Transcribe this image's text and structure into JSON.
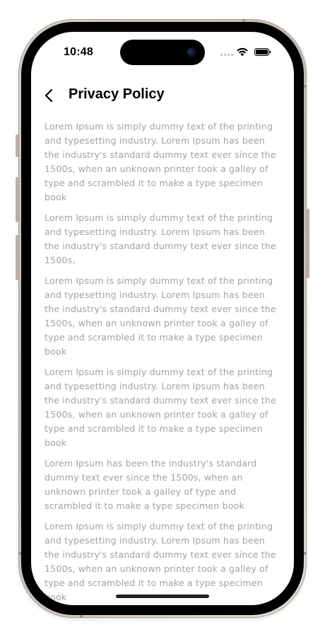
{
  "status_bar": {
    "time": "10:48"
  },
  "header": {
    "title": "Privacy Policy",
    "back_icon": "chevron-left-icon"
  },
  "content": {
    "paragraphs": [
      "Lorem Ipsum is simply dummy text of the printing and typesetting industry. Lorem Ipsum has been the industry's standard dummy text ever since the 1500s, when an unknown printer took a galley of type and scrambled it to make a type specimen book",
      "Lorem Ipsum is simply dummy text of the printing and typesetting industry. Lorem Ipsum has been the industry's standard dummy text ever since the 1500s,",
      "Lorem Ipsum is simply dummy text of the printing and typesetting industry. Lorem Ipsum has been the industry's standard dummy text ever since the 1500s, when an unknown printer took a galley of type and scrambled it to make a type specimen book",
      "Lorem Ipsum is simply dummy text of the printing and typesetting industry. Lorem Ipsum has been the industry's standard dummy text ever since the 1500s, when an unknown printer took a galley of type and scrambled it to make a type specimen book",
      "Lorem Ipsum has been the industry's standard dummy text ever since the 1500s, when an unknown printer took a galley of type and scrambled it to make a type specimen book",
      "Lorem Ipsum is simply dummy text of the printing and typesetting industry. Lorem Ipsum has been the industry's standard dummy text ever since the 1500s, when an unknown printer took a galley of type and scrambled it to make a type specimen book"
    ]
  },
  "colors": {
    "body_text": "#a3a3a3",
    "title_text": "#000000",
    "frame": "#000000",
    "bezel": "#c9c1b6"
  },
  "icons": [
    "chevron-left-icon",
    "wifi-icon",
    "battery-icon",
    "camera-icon"
  ]
}
